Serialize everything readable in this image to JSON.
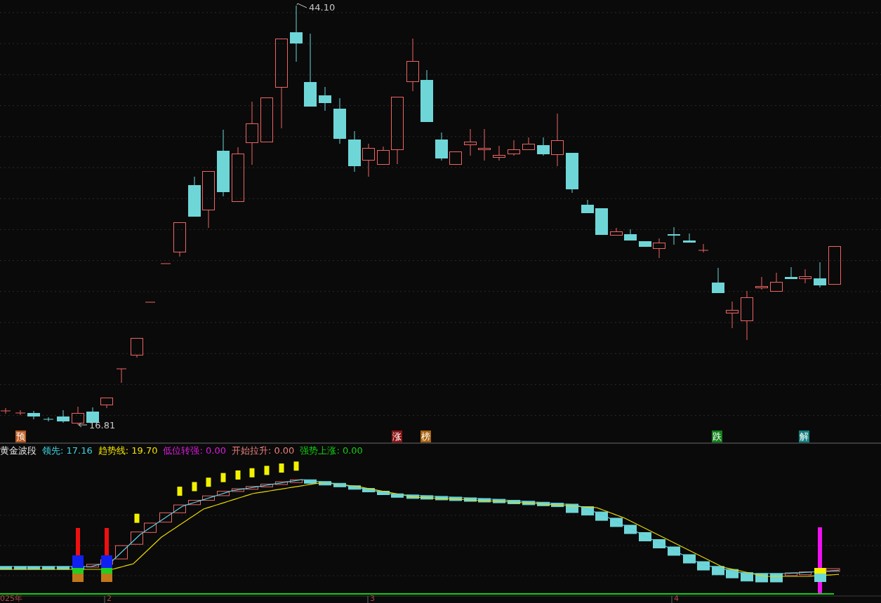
{
  "chart": {
    "high_label": "44.10",
    "low_label": "16.81",
    "signals": [
      {
        "text": "预",
        "color": "#b8561c"
      },
      {
        "text": "涨",
        "color": "#8a1414"
      },
      {
        "text": "榜",
        "color": "#a8620e"
      },
      {
        "text": "跌",
        "color": "#12801a"
      },
      {
        "text": "解",
        "color": "#137f80"
      }
    ]
  },
  "indicator": {
    "name": "黄金波段",
    "values": [
      {
        "label": "领先:",
        "value": "17.16",
        "color": "#3fd3e0"
      },
      {
        "label": "趋势线:",
        "value": "19.70",
        "color": "#f2e200"
      },
      {
        "label": "低位转强:",
        "value": "0.00",
        "color": "#e01ee0"
      },
      {
        "label": "开始拉升:",
        "value": "0.00",
        "color": "#ee8080"
      },
      {
        "label": "强势上涨:",
        "value": "0.00",
        "color": "#12d012"
      }
    ]
  },
  "time_axis": {
    "labels": [
      "025年",
      "2",
      "3",
      "4"
    ]
  }
}
